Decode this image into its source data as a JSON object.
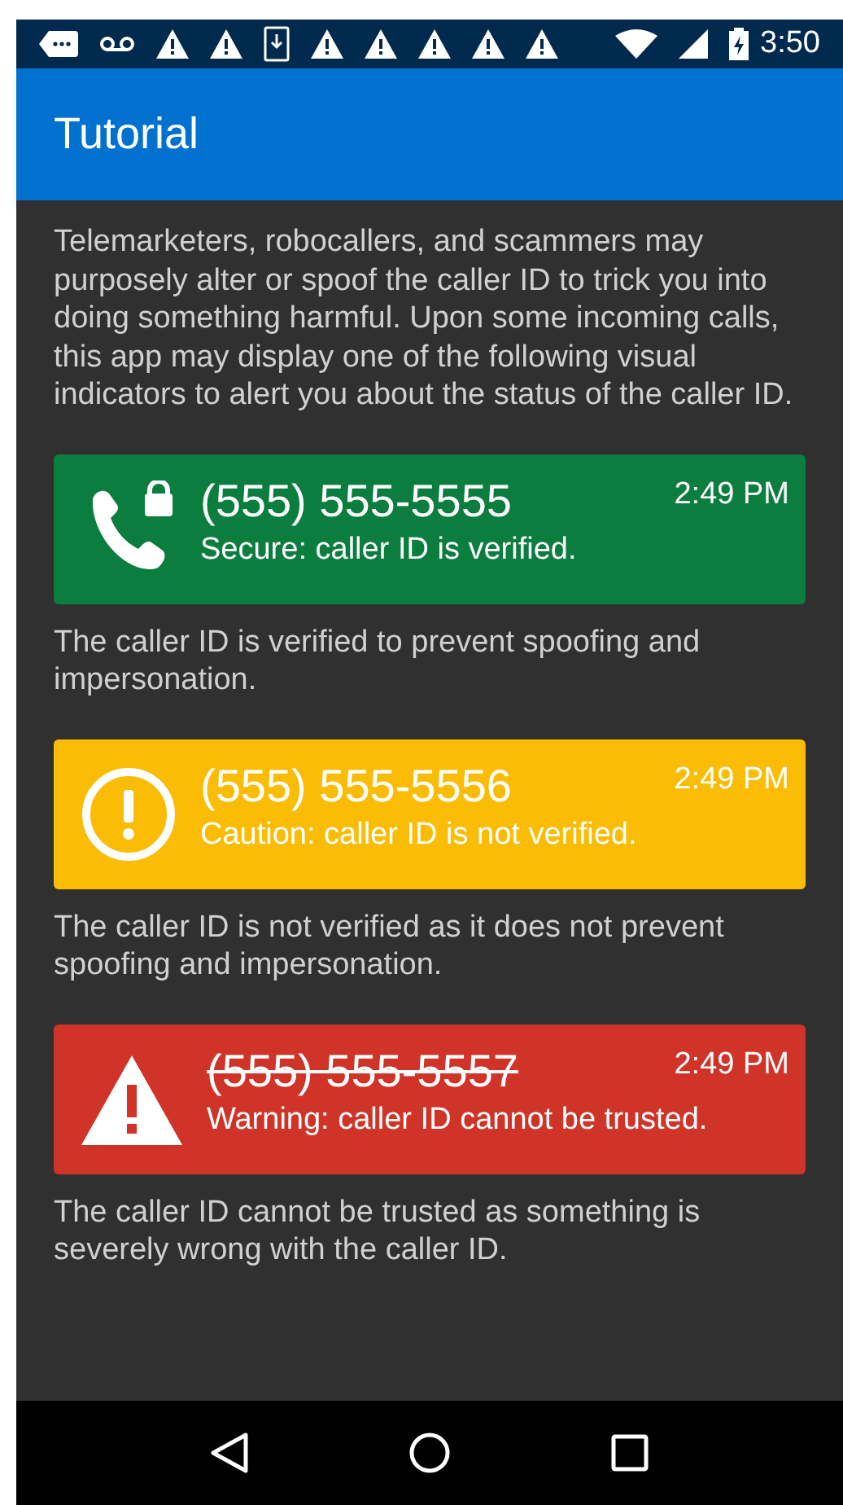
{
  "status_bar": {
    "time": "3:50"
  },
  "app_bar": {
    "title": "Tutorial"
  },
  "intro": "Telemarketers, robocallers, and scammers may purposely alter or spoof the caller ID to trick you into doing something harmful. Upon some incoming calls, this app may display one of the following visual indicators to alert you about the status of the caller ID.",
  "examples": [
    {
      "kind": "secure",
      "color": "#0b7d3e",
      "number": "(555) 555-5555",
      "struck": false,
      "time": "2:49 PM",
      "status": "Secure: caller ID is verified.",
      "description": "The caller ID is verified to prevent spoofing and impersonation."
    },
    {
      "kind": "caution",
      "color": "#fbbc05",
      "number": "(555) 555-5556",
      "struck": false,
      "time": "2:49 PM",
      "status": "Caution: caller ID is not verified.",
      "description": "The caller ID is not verified as it does not prevent spoofing and impersonation."
    },
    {
      "kind": "warning",
      "color": "#d03327",
      "number": "(555) 555-5557",
      "struck": true,
      "time": "2:49 PM",
      "status": "Warning: caller ID cannot be trusted.",
      "description": "The caller ID cannot be trusted as something is severely wrong with the caller ID."
    }
  ]
}
